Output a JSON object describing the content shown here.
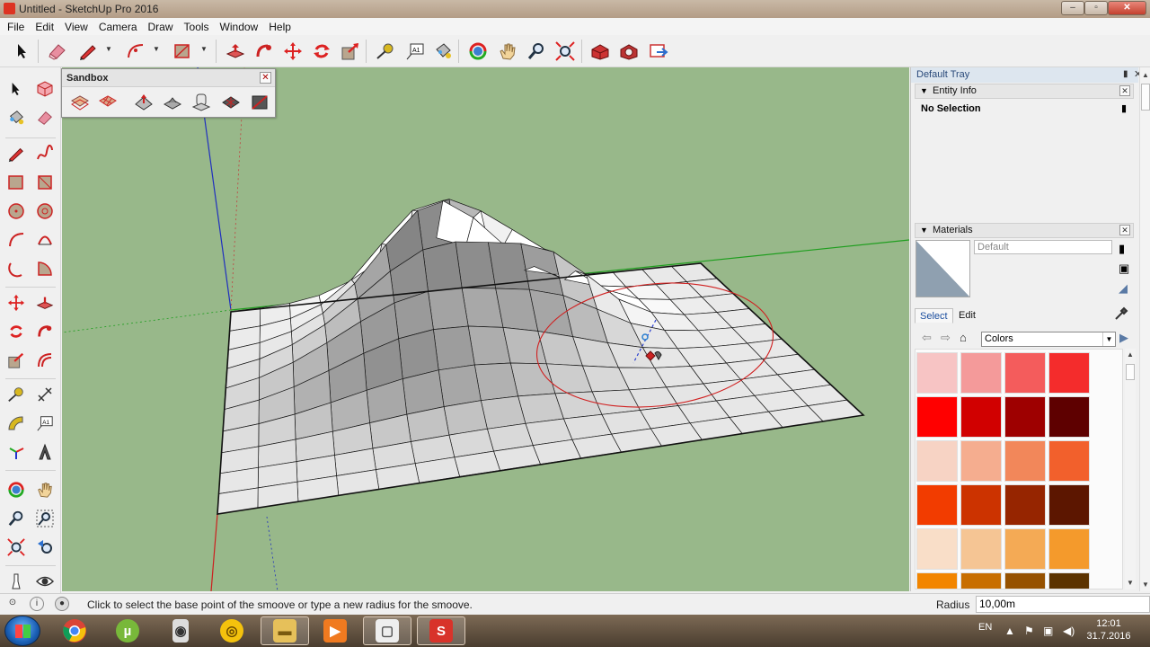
{
  "window": {
    "title": "Untitled - SketchUp Pro 2016",
    "minimize": "–",
    "maximize": "▫",
    "close": "✕"
  },
  "menu": [
    "File",
    "Edit",
    "View",
    "Camera",
    "Draw",
    "Tools",
    "Window",
    "Help"
  ],
  "toolbar": {
    "tools": [
      "select-tool",
      "eraser-tool",
      "line-tool",
      "arc-tool",
      "rectangle-tool",
      "push-pull-tool",
      "follow-me-tool",
      "move-tool",
      "rotate-tool",
      "scale-tool",
      "tape-measure-tool",
      "text-tool",
      "paint-bucket-tool",
      "orbit-tool",
      "pan-tool",
      "zoom-tool",
      "zoom-extents-tool",
      "3d-warehouse",
      "extension-warehouse",
      "layout-send"
    ],
    "text_icon_label": "A1"
  },
  "sandbox": {
    "title": "Sandbox",
    "tools": [
      "from-contours",
      "from-scratch",
      "smoove",
      "stamp",
      "drape",
      "add-detail",
      "flip-edge"
    ]
  },
  "tray": {
    "title": "Default Tray",
    "entity_info": {
      "title": "Entity Info",
      "value": "No Selection"
    },
    "materials": {
      "title": "Materials",
      "name_placeholder": "Default",
      "tab_select": "Select",
      "tab_edit": "Edit",
      "collection": "Colors",
      "swatches": [
        "#f7c4c4",
        "#f49a9a",
        "#f45c5c",
        "#f42c2c",
        "#ff0000",
        "#d10000",
        "#9e0000",
        "#5e0000",
        "#f7d3c4",
        "#f5ad8f",
        "#f2875a",
        "#f2602c",
        "#f23c00",
        "#cc3300",
        "#962500",
        "#5c1600",
        "#f9dec8",
        "#f5c594",
        "#f4aa55",
        "#f49a2c",
        "#f28500",
        "#c86e00",
        "#965100",
        "#5c3300"
      ]
    }
  },
  "left_toolbar": {
    "text_icon_label": "A1"
  },
  "status": {
    "message": "Click to select the base point of the smoove or type a new radius for the smoove.",
    "measure_label": "Radius",
    "measure_value": "10,00m"
  },
  "taskbar": {
    "language": "EN",
    "time": "12:01",
    "date": "31.7.2016",
    "apps": [
      "start",
      "chrome",
      "utorrent",
      "speaker-app",
      "media-player",
      "file-explorer",
      "media-player-classic",
      "window-app",
      "sketchup"
    ]
  },
  "colors": {
    "viewport_bg": "#98b88a",
    "axis_red": "#cc1f1f",
    "axis_green": "#1e9e1e",
    "axis_blue": "#1f2fbf",
    "smoove_circle": "#d02020"
  }
}
